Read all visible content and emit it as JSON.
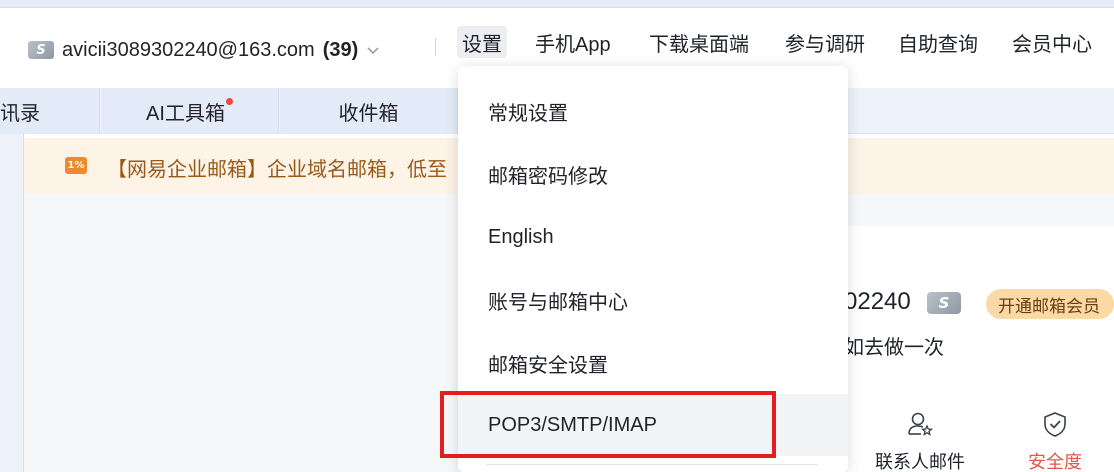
{
  "header": {
    "account_badge": "S",
    "account_email": "avicii3089302240@163.com",
    "unread_count": "(39)",
    "nav": [
      "设置",
      "手机App",
      "下载桌面端",
      "参与调研",
      "自助查询",
      "会员中心"
    ]
  },
  "tabs": {
    "items": [
      "讯录",
      "AI工具箱",
      "收件箱"
    ],
    "ai_tab_has_red_dot": true
  },
  "notice": {
    "icon_text": "1%",
    "text": "【网易企业邮箱】企业域名邮箱，低至"
  },
  "profile_card": {
    "name_fragment": "02240",
    "badge": "S",
    "vip_button": "开通邮箱会员",
    "subtitle_fragment": "如去做一次",
    "quick_actions": [
      {
        "label": "联系人邮件",
        "icon": "contact-star-icon",
        "color": "#1f2329"
      },
      {
        "label": "安全度",
        "icon": "shield-check-icon",
        "color": "#e0574d"
      }
    ]
  },
  "settings_menu": {
    "items": [
      "常规设置",
      "邮箱密码修改",
      "English",
      "账号与邮箱中心",
      "邮箱安全设置",
      "POP3/SMTP/IMAP"
    ],
    "hovered_item": "POP3/SMTP/IMAP",
    "highlighted_item": "POP3/SMTP/IMAP"
  },
  "colors": {
    "highlight_border": "#e41e1e",
    "notice_bg": "#fdf3e6",
    "notice_text": "#9a5a17",
    "vip_button_bg": "#fbd9a6",
    "tab_bg": "#e4ebf8"
  }
}
